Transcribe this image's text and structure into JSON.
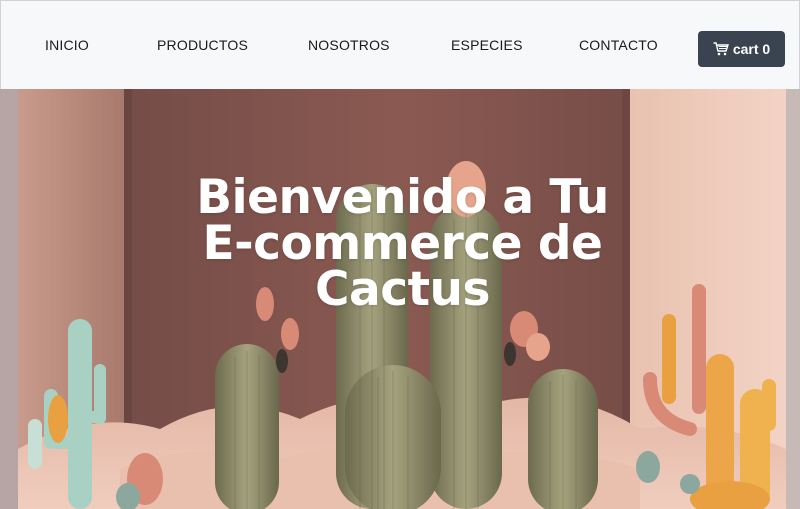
{
  "nav": {
    "items": [
      {
        "label": "INICIO"
      },
      {
        "label": "PRODUCTOS"
      },
      {
        "label": "NOSOTROS"
      },
      {
        "label": "ESPECIES"
      },
      {
        "label": "CONTACTO"
      }
    ],
    "cart": {
      "label": "cart 0",
      "icon": "cart-icon",
      "background": "#3a4350"
    }
  },
  "hero": {
    "title": "Bienvenido a Tu E-commerce de Cactus",
    "image": "cactus-hero-illustration"
  }
}
